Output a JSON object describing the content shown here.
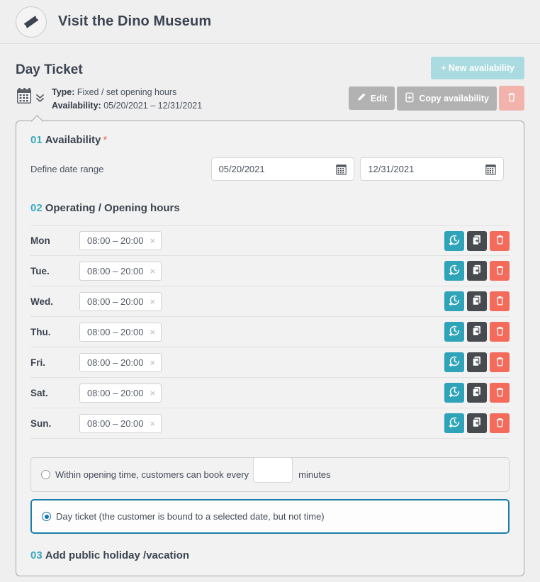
{
  "header": {
    "icon": "ticket-icon",
    "title": "Visit the Dino Museum"
  },
  "page": {
    "title": "Day Ticket",
    "new_availability_label": "+ New availability"
  },
  "meta": {
    "calendar_icon": "calendar-icon",
    "expand_icon": "chevron-double-down-icon",
    "type_label": "Type:",
    "type_value": "Fixed / set opening hours",
    "availability_label": "Availability:",
    "availability_value": "05/20/2021 – 12/31/2021",
    "edit_label": "Edit",
    "copy_label": "Copy availability",
    "delete_icon": "trash-icon"
  },
  "section1": {
    "number": "01",
    "title": "Availability",
    "required_marker": "*",
    "date_range_label": "Define date range",
    "start_date": "05/20/2021",
    "end_date": "12/31/2021"
  },
  "section2": {
    "number": "02",
    "title": "Operating / Opening hours",
    "days": [
      {
        "name": "Mon",
        "time": "08:00 – 20:00",
        "remove": "×"
      },
      {
        "name": "Tue.",
        "time": "08:00 – 20:00",
        "remove": "×"
      },
      {
        "name": "Wed.",
        "time": "08:00 – 20:00",
        "remove": "×"
      },
      {
        "name": "Thu.",
        "time": "08:00 – 20:00",
        "remove": "×"
      },
      {
        "name": "Fri.",
        "time": "08:00 – 20:00",
        "remove": "×"
      },
      {
        "name": "Sat.",
        "time": "08:00 – 20:00",
        "remove": "×"
      },
      {
        "name": "Sun.",
        "time": "08:00 – 20:00",
        "remove": "×"
      }
    ],
    "row_actions": {
      "add_time_icon": "clock-plus-icon",
      "copy_icon": "copy-plus-icon",
      "delete_icon": "trash-icon"
    }
  },
  "booking_mode": {
    "option_interval": {
      "text_before": "Within opening time, customers can book every",
      "minutes_value": "",
      "text_after": "minutes",
      "selected": false
    },
    "option_day_ticket": {
      "label": "Day ticket (the customer is bound to a selected date, but not time)",
      "selected": true
    }
  },
  "section3": {
    "number": "03",
    "title": "Add public holiday /vacation"
  },
  "colors": {
    "accent_teal": "#3aa9bd",
    "button_teal": "#2fa3b8",
    "button_teal_muted": "#a9dbe0",
    "button_dark": "#474a4e",
    "button_red": "#f46a5b",
    "button_red_muted": "#f2b3ac",
    "button_grey": "#b2b2b2",
    "selected_border": "#1b7ea8",
    "required_red": "#e8674f",
    "page_bg": "#efefef",
    "panel_bg": "#f2f2f2"
  }
}
